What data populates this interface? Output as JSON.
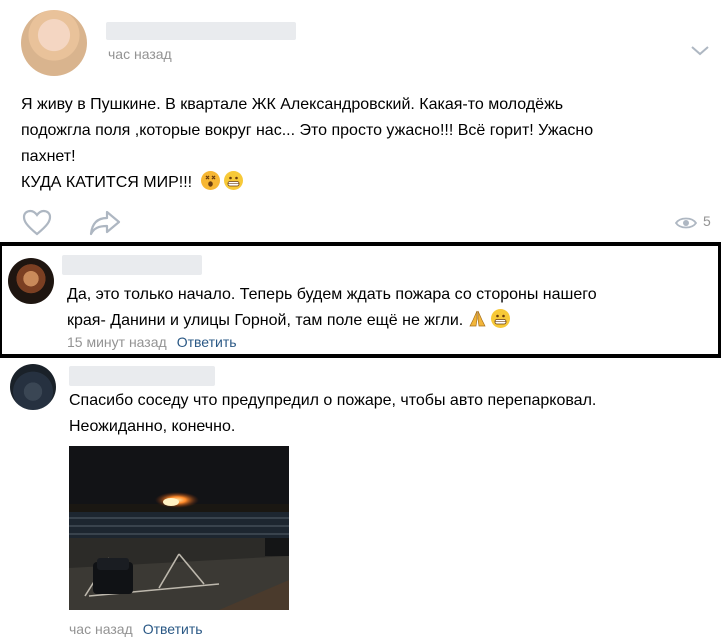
{
  "post": {
    "time": "час назад",
    "text_lines": [
      "Я живу в Пушкине. В квартале ЖК Александровский. Какая-то молодёжь",
      "подожгла поля ,которые вокруг нас... Это просто ужасно!!! Всё горит! Ужасно",
      "пахнет!",
      "КУДА КАТИТСЯ МИР!!!"
    ],
    "views": "5",
    "icons": {
      "menu": "chevron-down-icon",
      "like": "heart-icon",
      "share": "share-arrow-icon",
      "views": "eye-icon"
    }
  },
  "comments": [
    {
      "text_lines": [
        "Да, это только начало. Теперь будем ждать пожара со стороны нашего",
        "края- Данини и улицы Горной, там поле ещё не жгли."
      ],
      "time": "15 минут назад",
      "reply_label": "Ответить"
    },
    {
      "text_lines": [
        "Спасибо соседу что предупредил о пожаре, чтобы авто перепарковал.",
        "Неожиданно, конечно."
      ],
      "time": "час назад",
      "reply_label": "Ответить"
    }
  ],
  "colors": {
    "link": "#2a5885",
    "meta": "#939393",
    "icon": "#aeb7c2",
    "divider": "#000000"
  }
}
